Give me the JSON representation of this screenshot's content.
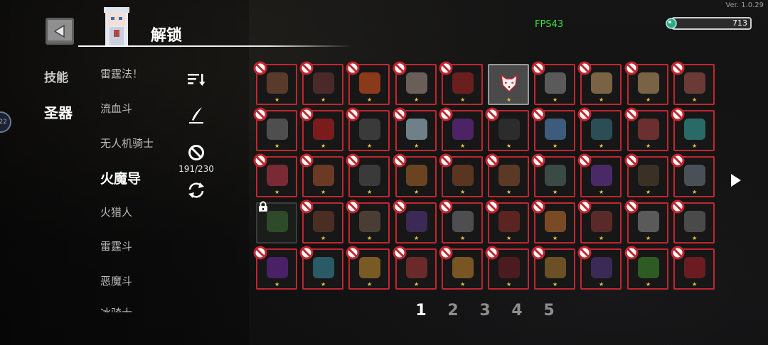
{
  "version": "Ver. 1.0.29",
  "header": {
    "title": "解锁",
    "fps": "FPS43",
    "gems": "713"
  },
  "side_indicator": "22",
  "categories": [
    {
      "label": "技能",
      "active": false
    },
    {
      "label": "圣器",
      "active": true
    }
  ],
  "characters": [
    {
      "label": "雷霆法！",
      "active": false
    },
    {
      "label": "流血斗",
      "active": false
    },
    {
      "label": "无人机骑士",
      "active": false
    },
    {
      "label": "火魔导",
      "active": true
    },
    {
      "label": "火猎人",
      "active": false
    },
    {
      "label": "雷霆斗",
      "active": false
    },
    {
      "label": "恶魔斗",
      "active": false
    },
    {
      "label": "冰骑士",
      "active": false
    }
  ],
  "tools": {
    "sort_icon": "sort-icon",
    "feather_icon": "quill-icon",
    "ban_icon": "ban-icon",
    "refresh_icon": "refresh-icon",
    "ban_count": "191/230"
  },
  "colors": {
    "ban_red": "#c2262f",
    "fps_green": "#3ee03e",
    "star_gold": "#e8c540"
  },
  "relics": [
    [
      {
        "icon": "bread-relic-icon",
        "color": "#5a3b2b",
        "state": "banned"
      },
      {
        "icon": "fruit-relic-icon",
        "color": "#4a2a28",
        "state": "banned"
      },
      {
        "icon": "crystal-relic-icon",
        "color": "#8a3a1a",
        "state": "banned"
      },
      {
        "icon": "feather-relic-icon",
        "color": "#6a5e58",
        "state": "banned"
      },
      {
        "icon": "potion-relic-icon",
        "color": "#6a1f1f",
        "state": "banned"
      },
      {
        "icon": "fox-mask-relic-icon",
        "color": "#f2f2f2",
        "state": "unlocked"
      },
      {
        "icon": "skull-relic-icon",
        "color": "#5a5a5a",
        "state": "banned"
      },
      {
        "icon": "scroll-relic-icon",
        "color": "#7a6244",
        "state": "banned"
      },
      {
        "icon": "scroll-relic-icon",
        "color": "#7a6244",
        "state": "banned"
      },
      {
        "icon": "meat-relic-icon",
        "color": "#6a3b35",
        "state": "banned"
      }
    ],
    [
      {
        "icon": "gender-relic-icon",
        "color": "#4e4e4e",
        "state": "banned"
      },
      {
        "icon": "demon-relic-icon",
        "color": "#7a1c1c",
        "state": "banned"
      },
      {
        "icon": "helmet-relic-icon",
        "color": "#3a3a3a",
        "state": "banned"
      },
      {
        "icon": "shard-relic-icon",
        "color": "#6f8088",
        "state": "banned"
      },
      {
        "icon": "gem-relic-icon",
        "color": "#4c2466",
        "state": "banned"
      },
      {
        "icon": "egg-relic-icon",
        "color": "#2c2c2c",
        "state": "banned"
      },
      {
        "icon": "cloud-relic-icon",
        "color": "#3d5b7a",
        "state": "banned"
      },
      {
        "icon": "tree-relic-icon",
        "color": "#2b4d55",
        "state": "banned"
      },
      {
        "icon": "mushroom-relic-icon",
        "color": "#6b2f2f",
        "state": "banned"
      },
      {
        "icon": "orb-relic-icon",
        "color": "#2a6a66",
        "state": "banned"
      }
    ],
    [
      {
        "icon": "scarf-relic-icon",
        "color": "#7a2a35",
        "state": "banned"
      },
      {
        "icon": "vase-relic-icon",
        "color": "#6a3a24",
        "state": "banned"
      },
      {
        "icon": "racket-relic-icon",
        "color": "#3a3a3a",
        "state": "banned"
      },
      {
        "icon": "boomerang-relic-icon",
        "color": "#6a4420",
        "state": "banned"
      },
      {
        "icon": "gloves-relic-icon",
        "color": "#5a3520",
        "state": "banned"
      },
      {
        "icon": "chocolate-relic-icon",
        "color": "#5a3a24",
        "state": "banned"
      },
      {
        "icon": "snowglobe-relic-icon",
        "color": "#3a4a44",
        "state": "banned"
      },
      {
        "icon": "jar-relic-icon",
        "color": "#4a2a66",
        "state": "banned"
      },
      {
        "icon": "book-relic-icon",
        "color": "#3a3024",
        "state": "banned"
      },
      {
        "icon": "hat-relic-icon",
        "color": "#4a5058",
        "state": "banned"
      }
    ],
    [
      {
        "icon": "rune-relic-icon",
        "color": "#2e4a2a",
        "state": "locked"
      },
      {
        "icon": "gun-relic-icon",
        "color": "#4a2e24",
        "state": "banned"
      },
      {
        "icon": "bag-relic-icon",
        "color": "#4a3e34",
        "state": "banned"
      },
      {
        "icon": "staff-relic-icon",
        "color": "#3a2a55",
        "state": "banned"
      },
      {
        "icon": "swords-relic-icon",
        "color": "#4e4e50",
        "state": "banned"
      },
      {
        "icon": "leaf-relic-icon",
        "color": "#5a2420",
        "state": "banned"
      },
      {
        "icon": "ticket-relic-icon",
        "color": "#7a4a24",
        "state": "banned"
      },
      {
        "icon": "wing-relic-icon",
        "color": "#5a2a2a",
        "state": "banned"
      },
      {
        "icon": "dagger-relic-icon",
        "color": "#5a5a5a",
        "state": "banned"
      },
      {
        "icon": "knife-relic-icon",
        "color": "#4a4a4a",
        "state": "banned"
      }
    ],
    [
      {
        "icon": "eye-relic-icon",
        "color": "#4a2066",
        "state": "banned"
      },
      {
        "icon": "robot-relic-icon",
        "color": "#2a5a66",
        "state": "banned"
      },
      {
        "icon": "gold-bar-relic-icon",
        "color": "#7a5a24",
        "state": "banned"
      },
      {
        "icon": "boot-relic-icon",
        "color": "#6a2a2a",
        "state": "banned"
      },
      {
        "icon": "coin-relic-icon",
        "color": "#7a5524",
        "state": "banned"
      },
      {
        "icon": "spider-relic-icon",
        "color": "#4a1c20",
        "state": "banned"
      },
      {
        "icon": "cookie-relic-icon",
        "color": "#6a5024",
        "state": "banned"
      },
      {
        "icon": "cauldron-relic-icon",
        "color": "#3a2a55",
        "state": "banned"
      },
      {
        "icon": "berries-relic-icon",
        "color": "#2e5a24",
        "state": "banned"
      },
      {
        "icon": "heart-relic-icon",
        "color": "#6a1c20",
        "state": "banned"
      }
    ]
  ],
  "star": "★",
  "pagination": {
    "pages": [
      "1",
      "2",
      "3",
      "4",
      "5"
    ],
    "current": 0
  }
}
